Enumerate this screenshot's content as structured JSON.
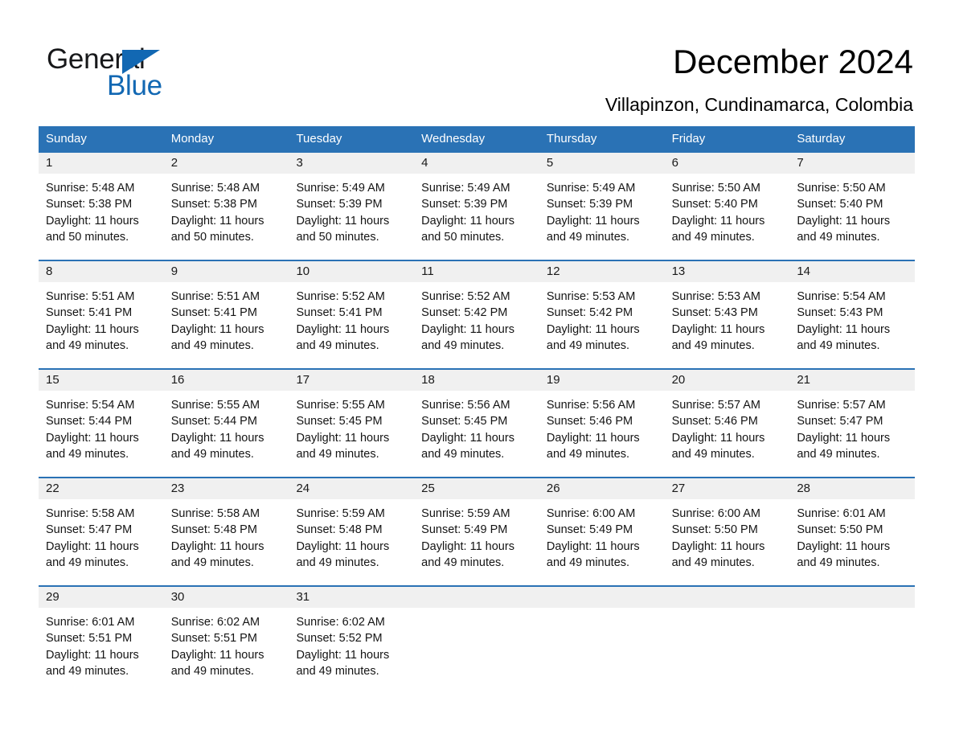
{
  "brand": {
    "name_part1": "General",
    "name_part2": "Blue"
  },
  "header": {
    "title": "December 2024",
    "location": "Villapinzon, Cundinamarca, Colombia"
  },
  "colors": {
    "header_blue": "#2a72b5",
    "logo_blue": "#1268b3",
    "daynum_bar": "#f0f0f0"
  },
  "weekdays": [
    "Sunday",
    "Monday",
    "Tuesday",
    "Wednesday",
    "Thursday",
    "Friday",
    "Saturday"
  ],
  "weeks": [
    [
      {
        "day": "1",
        "sunrise": "Sunrise: 5:48 AM",
        "sunset": "Sunset: 5:38 PM",
        "daylight1": "Daylight: 11 hours",
        "daylight2": "and 50 minutes."
      },
      {
        "day": "2",
        "sunrise": "Sunrise: 5:48 AM",
        "sunset": "Sunset: 5:38 PM",
        "daylight1": "Daylight: 11 hours",
        "daylight2": "and 50 minutes."
      },
      {
        "day": "3",
        "sunrise": "Sunrise: 5:49 AM",
        "sunset": "Sunset: 5:39 PM",
        "daylight1": "Daylight: 11 hours",
        "daylight2": "and 50 minutes."
      },
      {
        "day": "4",
        "sunrise": "Sunrise: 5:49 AM",
        "sunset": "Sunset: 5:39 PM",
        "daylight1": "Daylight: 11 hours",
        "daylight2": "and 50 minutes."
      },
      {
        "day": "5",
        "sunrise": "Sunrise: 5:49 AM",
        "sunset": "Sunset: 5:39 PM",
        "daylight1": "Daylight: 11 hours",
        "daylight2": "and 49 minutes."
      },
      {
        "day": "6",
        "sunrise": "Sunrise: 5:50 AM",
        "sunset": "Sunset: 5:40 PM",
        "daylight1": "Daylight: 11 hours",
        "daylight2": "and 49 minutes."
      },
      {
        "day": "7",
        "sunrise": "Sunrise: 5:50 AM",
        "sunset": "Sunset: 5:40 PM",
        "daylight1": "Daylight: 11 hours",
        "daylight2": "and 49 minutes."
      }
    ],
    [
      {
        "day": "8",
        "sunrise": "Sunrise: 5:51 AM",
        "sunset": "Sunset: 5:41 PM",
        "daylight1": "Daylight: 11 hours",
        "daylight2": "and 49 minutes."
      },
      {
        "day": "9",
        "sunrise": "Sunrise: 5:51 AM",
        "sunset": "Sunset: 5:41 PM",
        "daylight1": "Daylight: 11 hours",
        "daylight2": "and 49 minutes."
      },
      {
        "day": "10",
        "sunrise": "Sunrise: 5:52 AM",
        "sunset": "Sunset: 5:41 PM",
        "daylight1": "Daylight: 11 hours",
        "daylight2": "and 49 minutes."
      },
      {
        "day": "11",
        "sunrise": "Sunrise: 5:52 AM",
        "sunset": "Sunset: 5:42 PM",
        "daylight1": "Daylight: 11 hours",
        "daylight2": "and 49 minutes."
      },
      {
        "day": "12",
        "sunrise": "Sunrise: 5:53 AM",
        "sunset": "Sunset: 5:42 PM",
        "daylight1": "Daylight: 11 hours",
        "daylight2": "and 49 minutes."
      },
      {
        "day": "13",
        "sunrise": "Sunrise: 5:53 AM",
        "sunset": "Sunset: 5:43 PM",
        "daylight1": "Daylight: 11 hours",
        "daylight2": "and 49 minutes."
      },
      {
        "day": "14",
        "sunrise": "Sunrise: 5:54 AM",
        "sunset": "Sunset: 5:43 PM",
        "daylight1": "Daylight: 11 hours",
        "daylight2": "and 49 minutes."
      }
    ],
    [
      {
        "day": "15",
        "sunrise": "Sunrise: 5:54 AM",
        "sunset": "Sunset: 5:44 PM",
        "daylight1": "Daylight: 11 hours",
        "daylight2": "and 49 minutes."
      },
      {
        "day": "16",
        "sunrise": "Sunrise: 5:55 AM",
        "sunset": "Sunset: 5:44 PM",
        "daylight1": "Daylight: 11 hours",
        "daylight2": "and 49 minutes."
      },
      {
        "day": "17",
        "sunrise": "Sunrise: 5:55 AM",
        "sunset": "Sunset: 5:45 PM",
        "daylight1": "Daylight: 11 hours",
        "daylight2": "and 49 minutes."
      },
      {
        "day": "18",
        "sunrise": "Sunrise: 5:56 AM",
        "sunset": "Sunset: 5:45 PM",
        "daylight1": "Daylight: 11 hours",
        "daylight2": "and 49 minutes."
      },
      {
        "day": "19",
        "sunrise": "Sunrise: 5:56 AM",
        "sunset": "Sunset: 5:46 PM",
        "daylight1": "Daylight: 11 hours",
        "daylight2": "and 49 minutes."
      },
      {
        "day": "20",
        "sunrise": "Sunrise: 5:57 AM",
        "sunset": "Sunset: 5:46 PM",
        "daylight1": "Daylight: 11 hours",
        "daylight2": "and 49 minutes."
      },
      {
        "day": "21",
        "sunrise": "Sunrise: 5:57 AM",
        "sunset": "Sunset: 5:47 PM",
        "daylight1": "Daylight: 11 hours",
        "daylight2": "and 49 minutes."
      }
    ],
    [
      {
        "day": "22",
        "sunrise": "Sunrise: 5:58 AM",
        "sunset": "Sunset: 5:47 PM",
        "daylight1": "Daylight: 11 hours",
        "daylight2": "and 49 minutes."
      },
      {
        "day": "23",
        "sunrise": "Sunrise: 5:58 AM",
        "sunset": "Sunset: 5:48 PM",
        "daylight1": "Daylight: 11 hours",
        "daylight2": "and 49 minutes."
      },
      {
        "day": "24",
        "sunrise": "Sunrise: 5:59 AM",
        "sunset": "Sunset: 5:48 PM",
        "daylight1": "Daylight: 11 hours",
        "daylight2": "and 49 minutes."
      },
      {
        "day": "25",
        "sunrise": "Sunrise: 5:59 AM",
        "sunset": "Sunset: 5:49 PM",
        "daylight1": "Daylight: 11 hours",
        "daylight2": "and 49 minutes."
      },
      {
        "day": "26",
        "sunrise": "Sunrise: 6:00 AM",
        "sunset": "Sunset: 5:49 PM",
        "daylight1": "Daylight: 11 hours",
        "daylight2": "and 49 minutes."
      },
      {
        "day": "27",
        "sunrise": "Sunrise: 6:00 AM",
        "sunset": "Sunset: 5:50 PM",
        "daylight1": "Daylight: 11 hours",
        "daylight2": "and 49 minutes."
      },
      {
        "day": "28",
        "sunrise": "Sunrise: 6:01 AM",
        "sunset": "Sunset: 5:50 PM",
        "daylight1": "Daylight: 11 hours",
        "daylight2": "and 49 minutes."
      }
    ],
    [
      {
        "day": "29",
        "sunrise": "Sunrise: 6:01 AM",
        "sunset": "Sunset: 5:51 PM",
        "daylight1": "Daylight: 11 hours",
        "daylight2": "and 49 minutes."
      },
      {
        "day": "30",
        "sunrise": "Sunrise: 6:02 AM",
        "sunset": "Sunset: 5:51 PM",
        "daylight1": "Daylight: 11 hours",
        "daylight2": "and 49 minutes."
      },
      {
        "day": "31",
        "sunrise": "Sunrise: 6:02 AM",
        "sunset": "Sunset: 5:52 PM",
        "daylight1": "Daylight: 11 hours",
        "daylight2": "and 49 minutes."
      },
      {
        "day": "",
        "sunrise": "",
        "sunset": "",
        "daylight1": "",
        "daylight2": ""
      },
      {
        "day": "",
        "sunrise": "",
        "sunset": "",
        "daylight1": "",
        "daylight2": ""
      },
      {
        "day": "",
        "sunrise": "",
        "sunset": "",
        "daylight1": "",
        "daylight2": ""
      },
      {
        "day": "",
        "sunrise": "",
        "sunset": "",
        "daylight1": "",
        "daylight2": ""
      }
    ]
  ]
}
